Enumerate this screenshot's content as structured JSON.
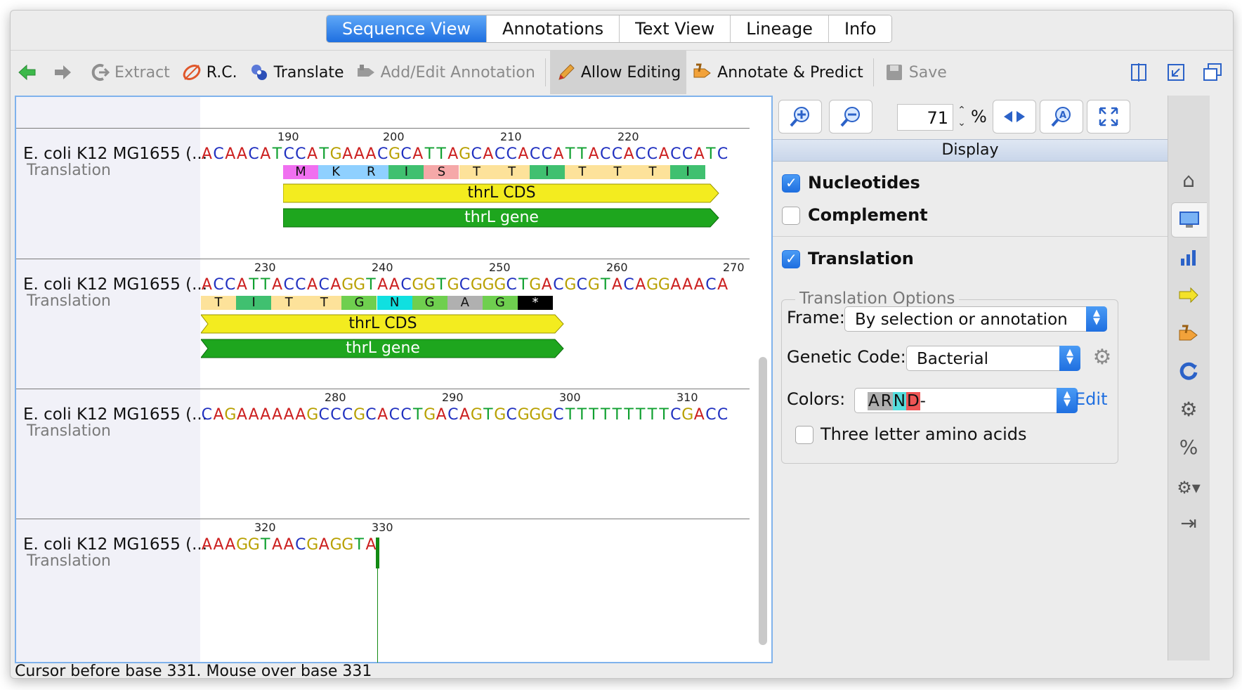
{
  "tabs": [
    {
      "label": "Sequence View",
      "active": true
    },
    {
      "label": "Annotations",
      "active": false
    },
    {
      "label": "Text View",
      "active": false
    },
    {
      "label": "Lineage",
      "active": false
    },
    {
      "label": "Info",
      "active": false
    }
  ],
  "toolbar": {
    "back_icon": "back-arrow-icon",
    "forward_icon": "forward-arrow-icon",
    "extract_label": "Extract",
    "rc_label": "R.C.",
    "translate_label": "Translate",
    "add_edit_label": "Add/Edit Annotation",
    "allow_editing_label": "Allow Editing",
    "annotate_predict_label": "Annotate & Predict",
    "save_label": "Save"
  },
  "sequence_rows": [
    {
      "name": "E. coli K12 MG1655 (...",
      "sub": "Translation",
      "ruler": [
        "190",
        "200",
        "210",
        "220"
      ],
      "bases": "ACAACATCCATGAAACGCATTAGCACCACCATTACCACCACCATC",
      "aa": [
        "M",
        "K",
        "R",
        "I",
        "S",
        "T",
        "T",
        "I",
        "T",
        "T",
        "T",
        "I"
      ],
      "features": [
        "thrL CDS",
        "thrL gene"
      ]
    },
    {
      "name": "E. coli K12 MG1655 (...",
      "sub": "Translation",
      "ruler": [
        "230",
        "240",
        "250",
        "260",
        "270"
      ],
      "bases": "ACCATTACCACAGGTAACGGTGCGGGCTGACGCGTACAGGAAACA",
      "aa": [
        "T",
        "I",
        "T",
        "T",
        "G",
        "N",
        "G",
        "A",
        "G",
        "*"
      ],
      "features": [
        "thrL CDS",
        "thrL gene"
      ]
    },
    {
      "name": "E. coli K12 MG1655 (...",
      "sub": "Translation",
      "ruler": [
        "280",
        "290",
        "300",
        "310"
      ],
      "bases": "CAGAAAAAAGCCCGCACCTGACAGTGCGGGCTTTTTTTTTCGACC",
      "aa": [],
      "features": []
    },
    {
      "name": "E. coli K12 MG1655 (...",
      "sub": "Translation",
      "ruler": [
        "320",
        "330"
      ],
      "bases": "AAAGGTAACGAGGTA",
      "aa": [],
      "features": []
    }
  ],
  "status": "Cursor before base 331. Mouse over base 331",
  "zoom": {
    "value": "71",
    "unit": "%"
  },
  "display": {
    "header": "Display",
    "nucleotides_label": "Nucleotides",
    "nucleotides_checked": true,
    "complement_label": "Complement",
    "complement_checked": false,
    "translation_label": "Translation",
    "translation_checked": true,
    "options_legend": "Translation Options",
    "frame_label": "Frame:",
    "frame_value": "By selection or annotation",
    "genetic_code_label": "Genetic Code:",
    "genetic_code_value": "Bacterial",
    "colors_label": "Colors:",
    "colors_value_suffix": "-",
    "edit_label": "Edit",
    "three_letter_label": "Three letter amino acids",
    "three_letter_checked": false
  },
  "colors": {
    "A": "#cc2020",
    "C": "#2030c0",
    "G": "#b8a000",
    "T": "#10a030",
    "cds": "#f3ec1f",
    "gene": "#1ea61e",
    "accent": "#1f6fe0"
  }
}
